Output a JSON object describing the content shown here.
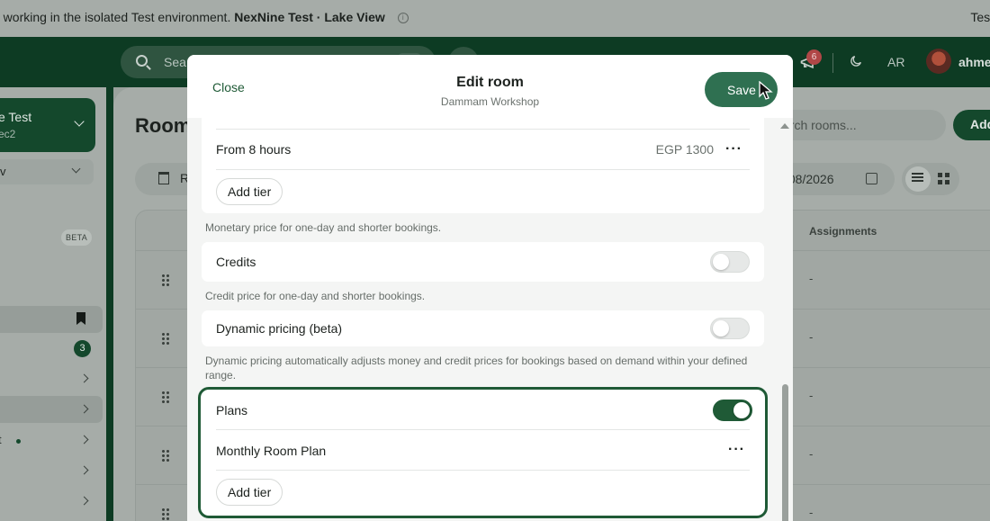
{
  "banner": {
    "message_prefix": "e working in the isolated Test environment. ",
    "message_strong": "NexNine Test · Lake View",
    "info_glyph": "i",
    "right_text": "Test"
  },
  "topbar": {
    "search_placeholder": "Sea",
    "notifications_count": "6",
    "language": "AR",
    "user_name": "ahme"
  },
  "sidebar": {
    "org_name": "e Test",
    "org_sub": "ec2",
    "selector_label": "v",
    "beta_label": "BETA",
    "badge_count": "3",
    "item_t": "t"
  },
  "main": {
    "page_title": "Room",
    "tab_label": "R",
    "search_placeholder": "arch rooms...",
    "add_button": "Add",
    "date_value": "/08/2026",
    "column_assignments": "Assignments",
    "rows": [
      {
        "assignments": "-"
      },
      {
        "assignments": "-"
      },
      {
        "assignments": "-"
      },
      {
        "assignments": "-"
      },
      {
        "assignments": "-"
      }
    ]
  },
  "modal": {
    "close_label": "Close",
    "title": "Edit room",
    "subtitle": "Dammam Workshop",
    "save_label": "Save",
    "price_tier": {
      "label": "From 8 hours",
      "price": "EGP 1300",
      "more": "···",
      "add_tier_label": "Add tier"
    },
    "monetary_help": "Monetary price for one-day and shorter bookings.",
    "credits": {
      "label": "Credits",
      "enabled": false
    },
    "credits_help": "Credit price for one-day and shorter bookings.",
    "dynamic_pricing": {
      "label": "Dynamic pricing (beta)",
      "enabled": false
    },
    "dynamic_help": "Dynamic pricing automatically adjusts money and credit prices for bookings based on demand within your defined range.",
    "plans": {
      "label": "Plans",
      "enabled": true,
      "plan_name": "Monthly Room Plan",
      "more": "···",
      "add_tier_label": "Add tier"
    }
  },
  "colors": {
    "brand_dark": "#0d3b23",
    "brand": "#1f5a36",
    "save_button": "#2f7051",
    "highlight_border": "#1f5a36"
  }
}
